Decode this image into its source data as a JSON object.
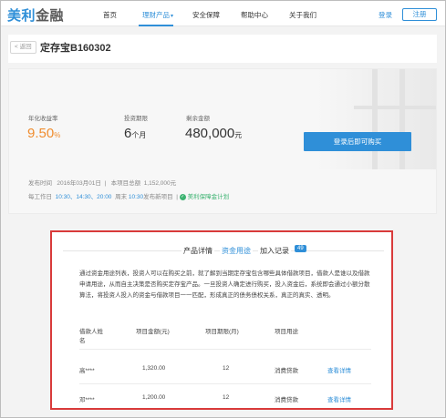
{
  "header": {
    "logo_part1": "美利",
    "logo_part2": "金融",
    "nav": [
      "首页",
      "理财产品",
      "安全保障",
      "帮助中心",
      "关于我们"
    ],
    "login": "登录",
    "register": "注册"
  },
  "titlebar": {
    "back": "< 返回",
    "title": "定存宝B160302"
  },
  "info": {
    "rate_label": "年化收益率",
    "rate_value": "9.50",
    "rate_unit": "%",
    "period_label": "投资期限",
    "period_value": "6",
    "period_unit": "个月",
    "amount_label": "剩余金额",
    "amount_value": "480,000",
    "amount_unit": "元",
    "buy_button": "登录后即可购买",
    "publish_label": "发布时间",
    "publish_date": "2016年03月01日",
    "total_label": "本项目总额",
    "total_value": "1,152,000元",
    "daily_label": "每工作日",
    "daily_times": "10:30、14:30、20:00",
    "weekend_label": "周末",
    "weekend_time": "10:30",
    "weekend_suffix": "发布新项目",
    "guarantee": "美利保障金计划"
  },
  "content": {
    "tabs": [
      "产品详情",
      "资金用途",
      "加入记录"
    ],
    "badge": "49",
    "description": "通过资金用途列表，投资人可以在购买之前，就了解到当期定存宝包含哪些具体借款项目，借款人是谁以及借款申请用途，从而自主决策是否购买定存宝产品。一旦投资人确定进行购买，投入资金后，系统即会通过小额分散算法，将投资人投入的资金与借款项目一一匹配，形成真正的债务债权关系，真正的真实、透明。",
    "columns": [
      "借款人姓名",
      "项目金额(元)",
      "项目期限(月)",
      "项目用途"
    ],
    "rows": [
      {
        "name": "高****",
        "amount": "1,320.00",
        "term": "12",
        "purpose": "消费贷款",
        "link": "查看详情"
      },
      {
        "name": "邓****",
        "amount": "1,200.00",
        "term": "12",
        "purpose": "消费贷款",
        "link": "查看详情"
      }
    ]
  }
}
